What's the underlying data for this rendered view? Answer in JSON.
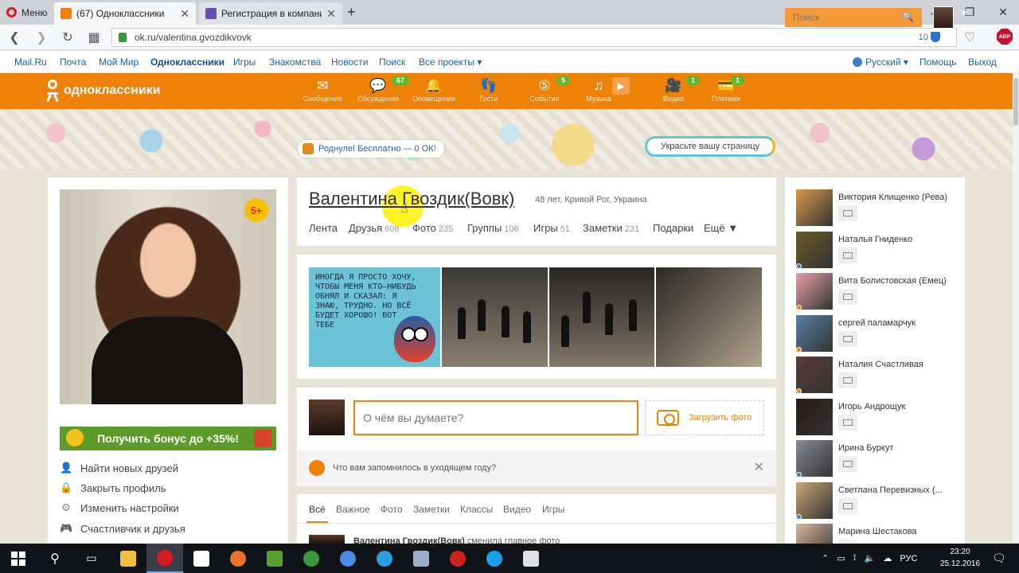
{
  "browser": {
    "menu_label": "Меню",
    "tabs": [
      {
        "label": "(67) Одноклассники",
        "active": true,
        "color": "#ee8208"
      },
      {
        "label": "Регистрация в компании",
        "active": false,
        "color": "#6a4fb0"
      }
    ],
    "url": "ok.ru/valentina.gvozdikvovk",
    "blocked_count": "10"
  },
  "mailnav": {
    "items": [
      "Mail.Ru",
      "Почта",
      "Мой Мир",
      "Одноклассники",
      "Игры",
      "Знакомства",
      "Новости",
      "Поиск",
      "Все проекты ▾"
    ],
    "language": "Русский ▾",
    "help": "Помощь",
    "logout": "Выход"
  },
  "ok_header": {
    "logo_text": "одноклассники",
    "nav": [
      {
        "label": "Сообщения",
        "icon": "envelope-icon",
        "glyph": "✉",
        "badge": ""
      },
      {
        "label": "Обсуждения",
        "icon": "discussions-icon",
        "glyph": "💬",
        "badge": "67"
      },
      {
        "label": "Оповещения",
        "icon": "bell-icon",
        "glyph": "🔔",
        "badge": ""
      },
      {
        "label": "Гости",
        "icon": "footprints-icon",
        "glyph": "👣",
        "badge": ""
      },
      {
        "label": "События",
        "icon": "events-icon",
        "glyph": "⑤",
        "badge": "5"
      },
      {
        "label": "Музыка",
        "icon": "music-icon",
        "glyph": "♫",
        "badge": ""
      },
      {
        "label": "",
        "icon": "play-icon",
        "glyph": "▶",
        "badge": ""
      },
      {
        "label": "Видео",
        "icon": "video-camera-icon",
        "glyph": "🎥",
        "badge": "1"
      },
      {
        "label": "Платежи",
        "icon": "payments-icon",
        "glyph": "💳",
        "badge": "1"
      }
    ],
    "search_placeholder": "Поиск",
    "accent": "#ee8208"
  },
  "cover": {
    "promo": "Роднуле! Бесплатно — 0 ОК!",
    "decorate": "Украсьте вашу страницу"
  },
  "left": {
    "badge": "5+",
    "bonus": "Получить бонус до +35%!",
    "menu": [
      {
        "label": "Найти новых друзей",
        "icon": "person-icon",
        "glyph": "👤"
      },
      {
        "label": "Закрыть профиль",
        "icon": "lock-icon",
        "glyph": "🔒"
      },
      {
        "label": "Изменить настройки",
        "icon": "gear-icon",
        "glyph": "⚙"
      },
      {
        "label": "Счастливчик и друзья",
        "icon": "gamepad-icon",
        "glyph": "🎮"
      }
    ]
  },
  "profile": {
    "name": "Валентина Гвоздик(Вовк)",
    "meta": "48 лет, Кривой Рог, Украина",
    "tabs": [
      {
        "label": "Лента",
        "count": ""
      },
      {
        "label": "Друзья",
        "count": "608"
      },
      {
        "label": "Фото",
        "count": "235"
      },
      {
        "label": "Группы",
        "count": "106"
      },
      {
        "label": "Игры",
        "count": "51"
      },
      {
        "label": "Заметки",
        "count": "231"
      },
      {
        "label": "Подарки",
        "count": ""
      },
      {
        "label": "Ещё ▼",
        "count": ""
      }
    ]
  },
  "photos": {
    "quote": "ИНОГДА Я ПРОСТО ХОЧУ, ЧТОБЫ МЕНЯ КТО—НИБУДЬ ОБНЯЛ И СКАЗАЛ: Я ЗНАЮ, ТРУДНО. НО ВСЁ БУДЕТ ХОРОШО! ВОТ ТЕБЕ"
  },
  "post": {
    "placeholder": "О чём вы думаете?",
    "upload": "Загрузить фото",
    "memory": "Что вам запомнилось в уходящем году?"
  },
  "feed": {
    "tabs": [
      "Всё",
      "Важное",
      "Фото",
      "Заметки",
      "Классы",
      "Видео",
      "Игры"
    ],
    "peek_author": "Валентина Гвоздик(Вовк)",
    "peek_text": "сменила главное фото"
  },
  "friends": [
    {
      "name": "Виктория Клищенко (Рева)",
      "online": "",
      "color": "#d89a4a"
    },
    {
      "name": "Наталья Гниденко",
      "online": "#2f7fd8",
      "color": "#6a5a2a"
    },
    {
      "name": "Вита Болистовская (Емец)",
      "online": "#ee8208",
      "color": "#e8a0a8"
    },
    {
      "name": "сергей паламарчук",
      "online": "#ee8208",
      "color": "#5a7fa8"
    },
    {
      "name": "Наталия Счастливая",
      "online": "#ee8208",
      "color": "#5a3a3a"
    },
    {
      "name": "Игорь Андрощук",
      "online": "",
      "color": "#2a1a1a"
    },
    {
      "name": "Ирина Буркут",
      "online": "#2f7fd8",
      "color": "#8a8a96"
    },
    {
      "name": "Светлана Перевизных (...",
      "online": "#2f7fd8",
      "color": "#c9a877"
    },
    {
      "name": "Марина Шестакова",
      "online": "",
      "color": "#d8b8a0"
    }
  ],
  "taskbar": {
    "lang": "РУС",
    "time": "23:20",
    "date": "25.12.2016",
    "apps": [
      {
        "icon": "explorer-icon",
        "color": "#f0c040"
      },
      {
        "icon": "opera-icon",
        "color": "#d81b22"
      },
      {
        "icon": "store-icon",
        "color": "#ffffff"
      },
      {
        "icon": "firefox-icon",
        "color": "#e8722a"
      },
      {
        "icon": "app-icon",
        "color": "#5aa030"
      },
      {
        "icon": "chrome-icon",
        "color": "#3a9a3a"
      },
      {
        "icon": "chrome-icon",
        "color": "#4a8ae0"
      },
      {
        "icon": "telegram-icon",
        "color": "#2aa0e0"
      },
      {
        "icon": "notes-icon",
        "color": "#9ab0c8"
      },
      {
        "icon": "record-icon",
        "color": "#d02020"
      },
      {
        "icon": "skype-icon",
        "color": "#1aa0e8"
      },
      {
        "icon": "paint-icon",
        "color": "#e0e0e0"
      }
    ]
  }
}
